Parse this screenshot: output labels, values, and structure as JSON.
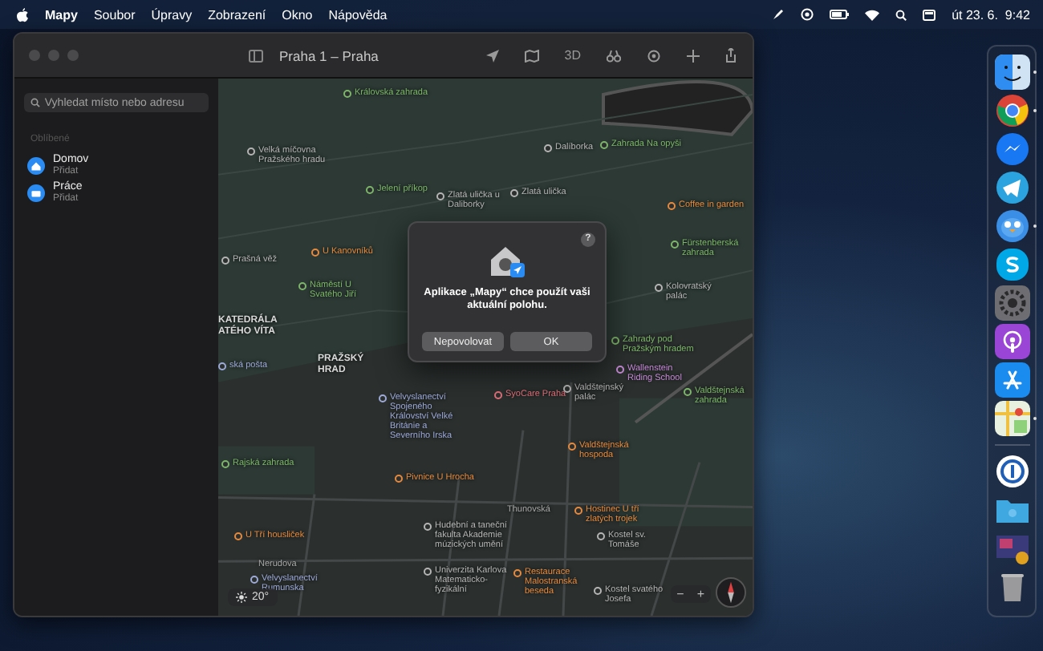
{
  "menu_bar": {
    "app_name": "Mapy",
    "items": [
      "Soubor",
      "Úpravy",
      "Zobrazení",
      "Okno",
      "Nápověda"
    ],
    "clock": "út 23. 6.  9:42"
  },
  "window": {
    "title": "Praha 1 – Praha",
    "view_button": "3D"
  },
  "sidebar": {
    "search": {
      "placeholder": "Vyhledat místo nebo adresu"
    },
    "section": "Oblíbené",
    "favorites": [
      {
        "kind": "home",
        "name": "Domov",
        "action": "Přidat"
      },
      {
        "kind": "work",
        "name": "Práce",
        "action": "Přidat"
      }
    ]
  },
  "map": {
    "labels": [
      {
        "kind": "park",
        "text": "Královská zahrada"
      },
      {
        "kind": "place",
        "text": "Velká míčovna Pražského hradu"
      },
      {
        "kind": "place",
        "text": "Dalíborka"
      },
      {
        "kind": "park",
        "text": "Zahrada Na opyši"
      },
      {
        "kind": "park",
        "text": "Jelení příkop"
      },
      {
        "kind": "place",
        "text": "Zlatá ulička u Daliborky"
      },
      {
        "kind": "place",
        "text": "Zlatá ulička"
      },
      {
        "kind": "food",
        "text": "Coffee in garden"
      },
      {
        "kind": "park",
        "text": "Fürstenberská zahrada"
      },
      {
        "kind": "place",
        "text": "Prašná věž"
      },
      {
        "kind": "food",
        "text": "U Kanovníků"
      },
      {
        "kind": "park",
        "text": "Náměstí U Svatého Jiří"
      },
      {
        "kind": "place",
        "text": "Kolovratský palác"
      },
      {
        "kind": "landmark",
        "text": "KATEDRÁLA ATÉHO VÍTA"
      },
      {
        "kind": "embassy",
        "text": "ská pošta"
      },
      {
        "kind": "landmark",
        "text": "PRAŽSKÝ HRAD"
      },
      {
        "kind": "park",
        "text": "Zahrady pod Pražským hradem"
      },
      {
        "kind": "attraction",
        "text": "Wallenstein Riding School"
      },
      {
        "kind": "embassy",
        "text": "Velvyslanectví Spojeného Království Velké Británie a Severního Irska"
      },
      {
        "kind": "health",
        "text": "SyoCare Praha"
      },
      {
        "kind": "place",
        "text": "Valdštejnský palác"
      },
      {
        "kind": "park",
        "text": "Valdštejnská zahrada"
      },
      {
        "kind": "food",
        "text": "Valdštejnská hospoda"
      },
      {
        "kind": "park",
        "text": "Rajská zahrada"
      },
      {
        "kind": "food",
        "text": "Pivnice U Hrocha"
      },
      {
        "kind": "street",
        "text": "Thunovská"
      },
      {
        "kind": "food",
        "text": "Hostinec U tří zlatých trojek"
      },
      {
        "kind": "food",
        "text": "U Tří housliček"
      },
      {
        "kind": "place",
        "text": "Hudební a taneční fakulta Akademie múzických umění"
      },
      {
        "kind": "place",
        "text": "Kostel sv. Tomáše"
      },
      {
        "kind": "street",
        "text": "Nerudova"
      },
      {
        "kind": "embassy",
        "text": "Velvyslanectví Rumunska"
      },
      {
        "kind": "place",
        "text": "Univerzita Karlova Matematicko-fyzikální"
      },
      {
        "kind": "food",
        "text": "Restaurace Malostranská beseda"
      },
      {
        "kind": "place",
        "text": "Kostel svatého Josefa"
      }
    ],
    "weather": "20°",
    "zoom_out": "−",
    "zoom_in": "+"
  },
  "dialog": {
    "help": "?",
    "message": "Aplikace „Mapy“ chce použít vaši aktuální polohu.",
    "buttons": [
      "Nepovolovat",
      "OK"
    ]
  },
  "dock": {
    "apps": [
      {
        "kind": "finder",
        "running": true
      },
      {
        "kind": "browser",
        "running": true
      },
      {
        "kind": "messenger",
        "running": false
      },
      {
        "kind": "telegram",
        "running": false
      },
      {
        "kind": "bird",
        "running": true
      },
      {
        "kind": "skype",
        "running": false
      },
      {
        "kind": "settings",
        "running": false
      },
      {
        "kind": "podcasts",
        "running": false
      },
      {
        "kind": "appstore",
        "running": false
      },
      {
        "kind": "maps",
        "running": true
      }
    ],
    "others": [
      {
        "kind": "password"
      },
      {
        "kind": "folder"
      },
      {
        "kind": "screenshot"
      },
      {
        "kind": "trash"
      }
    ]
  }
}
